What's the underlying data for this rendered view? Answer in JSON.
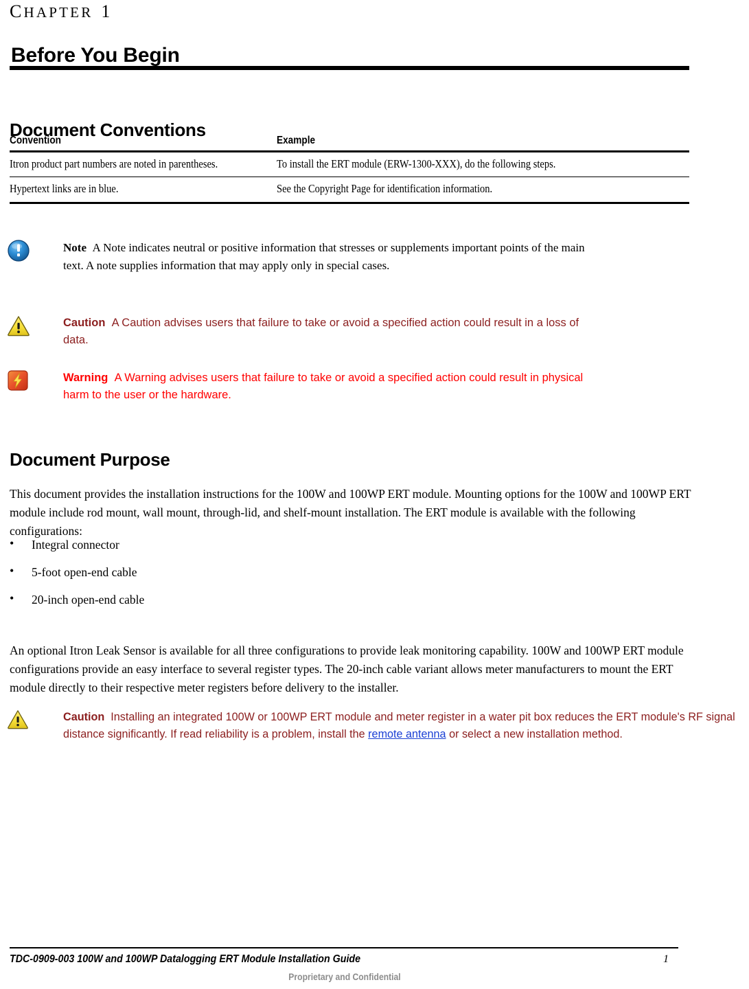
{
  "chapter": {
    "label_word": "CHAPTER",
    "label_first_letter": "C",
    "label_rest": "HAPTER",
    "number": "1",
    "title": "Before You Begin"
  },
  "sections": {
    "conventions_heading": "Document Conventions",
    "purpose_heading": "Document Purpose"
  },
  "conventions_table": {
    "headers": [
      "Convention",
      "Example"
    ],
    "rows": [
      {
        "convention": "Itron product part numbers are noted in parentheses.",
        "example": "To install the ERT module (ERW-1300-XXX), do the following steps."
      },
      {
        "convention": "Hypertext links are in blue.",
        "example": "See the Copyright Page for identification information."
      }
    ]
  },
  "admonitions": {
    "note": {
      "icon": "info-circle-icon",
      "label": "Note",
      "text": "A Note indicates neutral or positive information that stresses or supplements important points of the main text. A note supplies information that may apply only in special cases.",
      "color": "#000000"
    },
    "caution": {
      "icon": "warning-triangle-icon",
      "label": "Caution",
      "text": "A Caution advises users that failure to take or avoid a specified action could result in a loss of data.",
      "color": "#8c1f1f"
    },
    "warning": {
      "icon": "lightning-bolt-icon",
      "label": "Warning",
      "text": "A Warning advises users that failure to take or avoid a specified action could result in physical harm to the user or the hardware.",
      "color": "#ff0000"
    },
    "caution_install": {
      "icon": "warning-triangle-icon",
      "label": "Caution",
      "text_before_link": "Installing an integrated 100W or 100WP ERT module and meter register in a water pit box reduces the ERT module's RF signal distance significantly. If read reliability is a problem, install the ",
      "link_text": "remote antenna",
      "text_after_link": " or select a new installation method.",
      "color": "#8c1f1f",
      "link_color": "#1a3fd4"
    }
  },
  "body": {
    "purpose_paragraph": "This document provides the installation instructions for the 100W and 100WP ERT module. Mounting options for the 100W and 100WP ERT module include rod mount, wall mount, through-lid, and shelf-mount installation. The ERT module is available with the following configurations:",
    "configurations": [
      "Integral connector",
      "5-foot open-end cable",
      "20-inch open-end cable"
    ],
    "leak_sensor_paragraph": "An optional Itron Leak Sensor is available for all three configurations to provide leak monitoring capability. 100W and 100WP ERT module configurations provide an easy interface to several register types. The 20-inch cable variant allows meter manufacturers to mount the ERT module directly to their respective meter registers before delivery to the installer."
  },
  "footer": {
    "document_id_and_title": "TDC-0909-003 100W and 100WP Datalogging ERT Module Installation Guide",
    "page_number": "1",
    "confidentiality": "Proprietary and Confidential"
  }
}
